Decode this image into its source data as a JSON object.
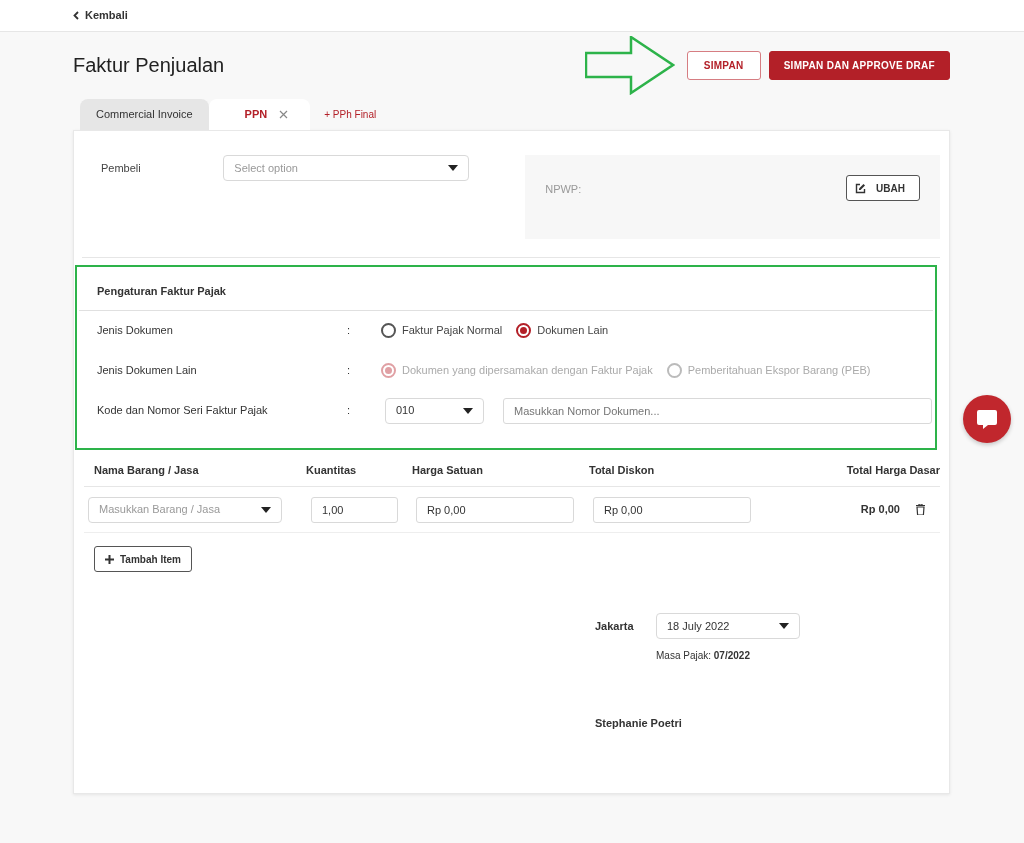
{
  "back_link": {
    "label": "Kembali"
  },
  "title": "Faktur Penjualan",
  "actions": [
    {
      "label": "SIMPAN",
      "kind": "outline"
    },
    {
      "label": "SIMPAN DAN APPROVE DRAF",
      "kind": "solid"
    }
  ],
  "tabs": [
    {
      "label": "Commercial Invoice",
      "selected": false,
      "closable": false
    },
    {
      "label": "PPN",
      "selected": true,
      "closable": true
    }
  ],
  "add_tab": "+ PPh Final",
  "buyer": {
    "label": "Pembeli",
    "placeholder": "Select option"
  },
  "npwp": {
    "label": "NPWP:",
    "button": "UBAH"
  },
  "tax_settings": {
    "title": "Pengaturan Faktur Pajak",
    "rows": [
      {
        "kind": "radio",
        "label": "Jenis Dokumen",
        "separator": ":",
        "options": [
          {
            "label": "Faktur Pajak Normal",
            "selected": false,
            "disabled": false
          },
          {
            "label": "Dokumen Lain",
            "selected": true,
            "disabled": false
          }
        ]
      },
      {
        "kind": "radio",
        "label": "Jenis Dokumen Lain",
        "separator": ":",
        "options": [
          {
            "label": "Dokumen yang dipersamakan dengan Faktur Pajak",
            "selected": true,
            "disabled": true
          },
          {
            "label": "Pemberitahuan Ekspor Barang (PEB)",
            "selected": false,
            "disabled": true
          }
        ]
      },
      {
        "kind": "code",
        "label": "Kode dan Nomor Seri Faktur Pajak",
        "separator": ":",
        "code": "010",
        "placeholder": "Masukkan Nomor Dokumen..."
      }
    ]
  },
  "items": {
    "columns": [
      "Nama Barang / Jasa",
      "Kuantitas",
      "Harga Satuan",
      "Total Diskon",
      "Total Harga Dasar"
    ],
    "rows": [
      {
        "name_placeholder": "Masukkan Barang / Jasa",
        "quantity": "1,00",
        "unit_price": "Rp 0,00",
        "discount": "Rp 0,00",
        "total": "Rp 0,00"
      }
    ],
    "add_button": "Tambah Item"
  },
  "signature": {
    "city": "Jakarta",
    "date": "18 July 2022",
    "period": "Masa Pajak: **07/2022**",
    "signer": "Stephanie Poetri"
  }
}
